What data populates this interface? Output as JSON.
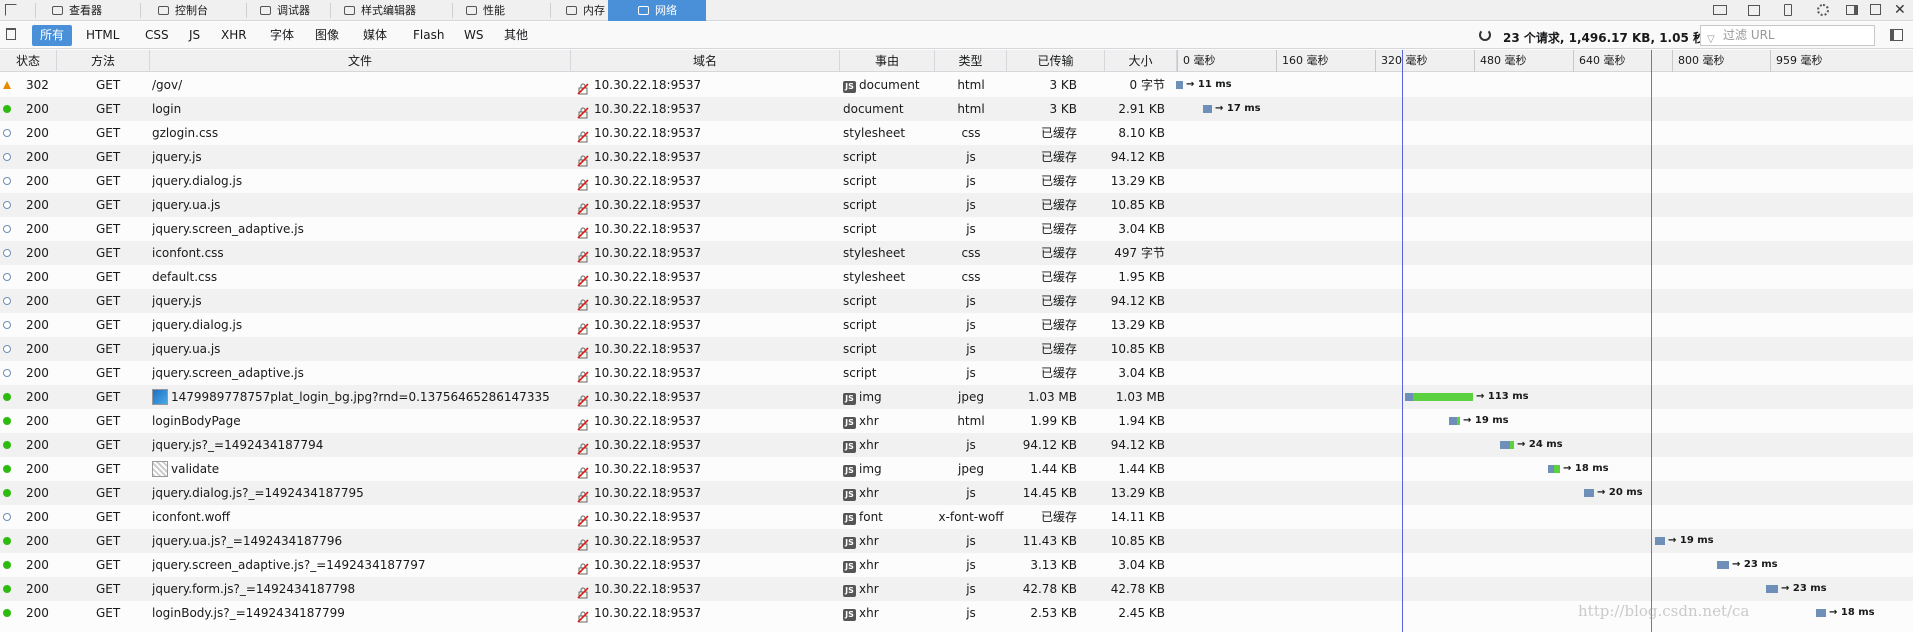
{
  "tabs": [
    {
      "label": "查看器",
      "icon": "inspector-icon"
    },
    {
      "label": "控制台",
      "icon": "console-icon"
    },
    {
      "label": "调试器",
      "icon": "debugger-icon"
    },
    {
      "label": "样式编辑器",
      "icon": "style-editor-icon"
    },
    {
      "label": "性能",
      "icon": "performance-icon"
    },
    {
      "label": "内存",
      "icon": "memory-icon"
    },
    {
      "label": "网络",
      "icon": "network-icon",
      "active": true
    }
  ],
  "filters": [
    "所有",
    "HTML",
    "CSS",
    "JS",
    "XHR",
    "字体",
    "图像",
    "媒体",
    "Flash",
    "WS",
    "其他"
  ],
  "summary": "23 个请求, 1,496.17 KB, 1.05 秒",
  "filter_placeholder": "过滤 URL",
  "columns": {
    "status": "状态",
    "method": "方法",
    "file": "文件",
    "domain": "域名",
    "cause": "事由",
    "type": "类型",
    "transferred": "已传输",
    "size": "大小"
  },
  "ticks": [
    "0 毫秒",
    "160 毫秒",
    "320 毫秒",
    "480 毫秒",
    "640 毫秒",
    "800 毫秒",
    "959 毫秒"
  ],
  "rows": [
    {
      "status": "302",
      "indicator": "redirect",
      "method": "GET",
      "file": "/gov/",
      "domain": "10.30.22.18:9537",
      "cause": "document",
      "cause_js": true,
      "type": "html",
      "transferred": "3 KB",
      "size": "0 字节",
      "timing": "→ 11 ms"
    },
    {
      "status": "200",
      "indicator": "ok",
      "method": "GET",
      "file": "login",
      "domain": "10.30.22.18:9537",
      "cause": "document",
      "cause_js": false,
      "type": "html",
      "transferred": "3 KB",
      "size": "2.91 KB",
      "timing": "→ 17 ms"
    },
    {
      "status": "200",
      "indicator": "cached",
      "method": "GET",
      "file": "gzlogin.css",
      "domain": "10.30.22.18:9537",
      "cause": "stylesheet",
      "cause_js": false,
      "type": "css",
      "transferred": "已缓存",
      "size": "8.10 KB",
      "timing": ""
    },
    {
      "status": "200",
      "indicator": "cached",
      "method": "GET",
      "file": "jquery.js",
      "domain": "10.30.22.18:9537",
      "cause": "script",
      "cause_js": false,
      "type": "js",
      "transferred": "已缓存",
      "size": "94.12 KB",
      "timing": ""
    },
    {
      "status": "200",
      "indicator": "cached",
      "method": "GET",
      "file": "jquery.dialog.js",
      "domain": "10.30.22.18:9537",
      "cause": "script",
      "cause_js": false,
      "type": "js",
      "transferred": "已缓存",
      "size": "13.29 KB",
      "timing": ""
    },
    {
      "status": "200",
      "indicator": "cached",
      "method": "GET",
      "file": "jquery.ua.js",
      "domain": "10.30.22.18:9537",
      "cause": "script",
      "cause_js": false,
      "type": "js",
      "transferred": "已缓存",
      "size": "10.85 KB",
      "timing": ""
    },
    {
      "status": "200",
      "indicator": "cached",
      "method": "GET",
      "file": "jquery.screen_adaptive.js",
      "domain": "10.30.22.18:9537",
      "cause": "script",
      "cause_js": false,
      "type": "js",
      "transferred": "已缓存",
      "size": "3.04 KB",
      "timing": ""
    },
    {
      "status": "200",
      "indicator": "cached",
      "method": "GET",
      "file": "iconfont.css",
      "domain": "10.30.22.18:9537",
      "cause": "stylesheet",
      "cause_js": false,
      "type": "css",
      "transferred": "已缓存",
      "size": "497 字节",
      "timing": ""
    },
    {
      "status": "200",
      "indicator": "cached",
      "method": "GET",
      "file": "default.css",
      "domain": "10.30.22.18:9537",
      "cause": "stylesheet",
      "cause_js": false,
      "type": "css",
      "transferred": "已缓存",
      "size": "1.95 KB",
      "timing": ""
    },
    {
      "status": "200",
      "indicator": "cached",
      "method": "GET",
      "file": "jquery.js",
      "domain": "10.30.22.18:9537",
      "cause": "script",
      "cause_js": false,
      "type": "js",
      "transferred": "已缓存",
      "size": "94.12 KB",
      "timing": ""
    },
    {
      "status": "200",
      "indicator": "cached",
      "method": "GET",
      "file": "jquery.dialog.js",
      "domain": "10.30.22.18:9537",
      "cause": "script",
      "cause_js": false,
      "type": "js",
      "transferred": "已缓存",
      "size": "13.29 KB",
      "timing": ""
    },
    {
      "status": "200",
      "indicator": "cached",
      "method": "GET",
      "file": "jquery.ua.js",
      "domain": "10.30.22.18:9537",
      "cause": "script",
      "cause_js": false,
      "type": "js",
      "transferred": "已缓存",
      "size": "10.85 KB",
      "timing": ""
    },
    {
      "status": "200",
      "indicator": "cached",
      "method": "GET",
      "file": "jquery.screen_adaptive.js",
      "domain": "10.30.22.18:9537",
      "cause": "script",
      "cause_js": false,
      "type": "js",
      "transferred": "已缓存",
      "size": "3.04 KB",
      "timing": ""
    },
    {
      "status": "200",
      "indicator": "ok",
      "method": "GET",
      "file": "1479989778757plat_login_bg.jpg?rnd=0.13756465286147335",
      "thumb": "bg",
      "domain": "10.30.22.18:9537",
      "cause": "img",
      "cause_js": true,
      "type": "jpeg",
      "transferred": "1.03 MB",
      "size": "1.03 MB",
      "timing": "→ 113 ms"
    },
    {
      "status": "200",
      "indicator": "ok",
      "method": "GET",
      "file": "loginBodyPage",
      "domain": "10.30.22.18:9537",
      "cause": "xhr",
      "cause_js": true,
      "type": "html",
      "transferred": "1.99 KB",
      "size": "1.94 KB",
      "timing": "→ 19 ms"
    },
    {
      "status": "200",
      "indicator": "ok",
      "method": "GET",
      "file": "jquery.js?_=1492434187794",
      "domain": "10.30.22.18:9537",
      "cause": "xhr",
      "cause_js": true,
      "type": "js",
      "transferred": "94.12 KB",
      "size": "94.12 KB",
      "timing": "→ 24 ms"
    },
    {
      "status": "200",
      "indicator": "ok",
      "method": "GET",
      "file": "validate",
      "thumb": "captcha",
      "domain": "10.30.22.18:9537",
      "cause": "img",
      "cause_js": true,
      "type": "jpeg",
      "transferred": "1.44 KB",
      "size": "1.44 KB",
      "timing": "→ 18 ms"
    },
    {
      "status": "200",
      "indicator": "ok",
      "method": "GET",
      "file": "jquery.dialog.js?_=1492434187795",
      "domain": "10.30.22.18:9537",
      "cause": "xhr",
      "cause_js": true,
      "type": "js",
      "transferred": "14.45 KB",
      "size": "13.29 KB",
      "timing": "→ 20 ms"
    },
    {
      "status": "200",
      "indicator": "cached",
      "method": "GET",
      "file": "iconfont.woff",
      "domain": "10.30.22.18:9537",
      "cause": "font",
      "cause_js": true,
      "type": "x-font-woff",
      "transferred": "已缓存",
      "size": "14.11 KB",
      "timing": ""
    },
    {
      "status": "200",
      "indicator": "ok",
      "method": "GET",
      "file": "jquery.ua.js?_=1492434187796",
      "domain": "10.30.22.18:9537",
      "cause": "xhr",
      "cause_js": true,
      "type": "js",
      "transferred": "11.43 KB",
      "size": "10.85 KB",
      "timing": "→ 19 ms"
    },
    {
      "status": "200",
      "indicator": "ok",
      "method": "GET",
      "file": "jquery.screen_adaptive.js?_=1492434187797",
      "domain": "10.30.22.18:9537",
      "cause": "xhr",
      "cause_js": true,
      "type": "js",
      "transferred": "3.13 KB",
      "size": "3.04 KB",
      "timing": "→ 23 ms"
    },
    {
      "status": "200",
      "indicator": "ok",
      "method": "GET",
      "file": "jquery.form.js?_=1492434187798",
      "domain": "10.30.22.18:9537",
      "cause": "xhr",
      "cause_js": true,
      "type": "js",
      "transferred": "42.78 KB",
      "size": "42.78 KB",
      "timing": "→ 23 ms"
    },
    {
      "status": "200",
      "indicator": "ok",
      "method": "GET",
      "file": "loginBody.js?_=1492434187799",
      "domain": "10.30.22.18:9537",
      "cause": "xhr",
      "cause_js": true,
      "type": "js",
      "transferred": "2.53 KB",
      "size": "2.45 KB",
      "timing": "→ 18 ms"
    }
  ],
  "watermark": "http://blog.csdn.net/ca",
  "colors": {
    "accent": "#4a90d9",
    "ok": "#2cbb0f",
    "redirect": "#e68a00",
    "wait": "#6d8fb8",
    "receive": "#5cd13f",
    "domcontent": "#5863d9",
    "load": "#e05050"
  }
}
